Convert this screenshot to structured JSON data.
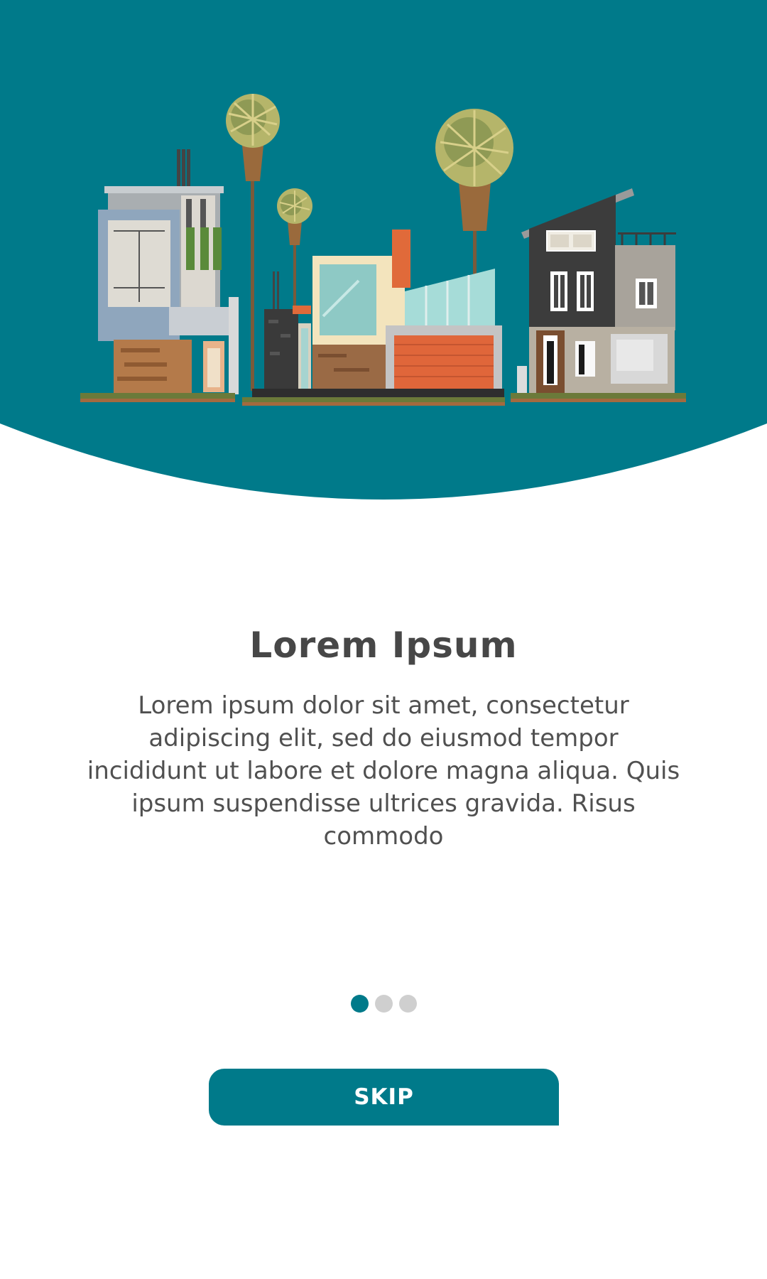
{
  "onboarding": {
    "title": "Lorem Ipsum",
    "description": "Lorem ipsum dolor sit amet, consectetur adipiscing elit, sed do eiusmod tempor incididunt ut labore et dolore magna aliqua. Quis ipsum suspendisse ultrices gravida. Risus commodo",
    "skip_label": "SKIP",
    "illustration": "houses-with-palm-trees-illustration"
  },
  "pagination": {
    "current_page": 1,
    "total_pages": 3
  },
  "colors": {
    "primary": "#007a8a",
    "dot_inactive": "#cfcfcf",
    "title_text": "#474747",
    "body_text": "#505050",
    "background": "#ffffff"
  }
}
